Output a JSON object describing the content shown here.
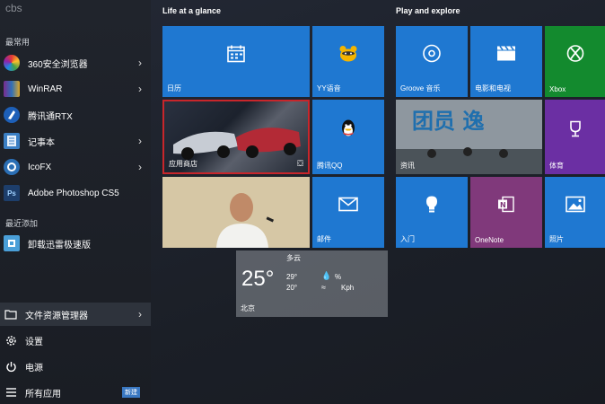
{
  "user_name": "cbs",
  "left": {
    "recent_label": "最常用",
    "apps": [
      {
        "label": "360安全浏览器",
        "icon": "360-browser-icon",
        "color": "#2a7de1",
        "has_arrow": true
      },
      {
        "label": "WinRAR",
        "icon": "winrar-icon",
        "color": "#6a3d8f",
        "has_arrow": true
      },
      {
        "label": "腾讯通RTX",
        "icon": "rtx-icon",
        "color": "#1d5fb8",
        "has_arrow": false
      },
      {
        "label": "记事本",
        "icon": "notepad-icon",
        "color": "#3b7fc4",
        "has_arrow": true
      },
      {
        "label": "IcoFX",
        "icon": "icofx-icon",
        "color": "#2b6fb5",
        "has_arrow": true
      },
      {
        "label": "Adobe Photoshop CS5",
        "icon": "photoshop-icon",
        "color": "#1d3e6b",
        "has_arrow": false
      }
    ],
    "new_label": "最近添加",
    "new_apps": [
      {
        "label": "卸载迅雷极速版",
        "icon": "uninstall-icon",
        "color": "#4a9fd8"
      }
    ],
    "bottom": {
      "explorer": "文件资源管理器",
      "settings": "设置",
      "power": "电源",
      "all_apps": "所有应用",
      "all_apps_badge": "新建"
    }
  },
  "groups": {
    "life_title": "Life at a glance",
    "play_title": "Play and explore"
  },
  "tiles": {
    "calendar": "日历",
    "yy": "YY语音",
    "store": "应用商店",
    "qq": "腾讯QQ",
    "photo": "",
    "mail": "邮件",
    "groove": "Groove 音乐",
    "movies": "电影和电视",
    "xbox": "Xbox",
    "news": "资讯",
    "sports": "体育",
    "tips": "入门",
    "onenote": "OneNote",
    "photos": "照片",
    "weather": {
      "condition": "多云",
      "temp": "25°",
      "high": "29°",
      "low": "20°",
      "humidity_unit": "%",
      "wind_unit": "Kph",
      "city": "北京"
    }
  },
  "colors": {
    "tile_blue": "#1f78d1",
    "xbox_green": "#138a2e",
    "sports_purple": "#6b2fa3",
    "onenote_purple": "#80397b",
    "store_border": "#c8262b"
  }
}
